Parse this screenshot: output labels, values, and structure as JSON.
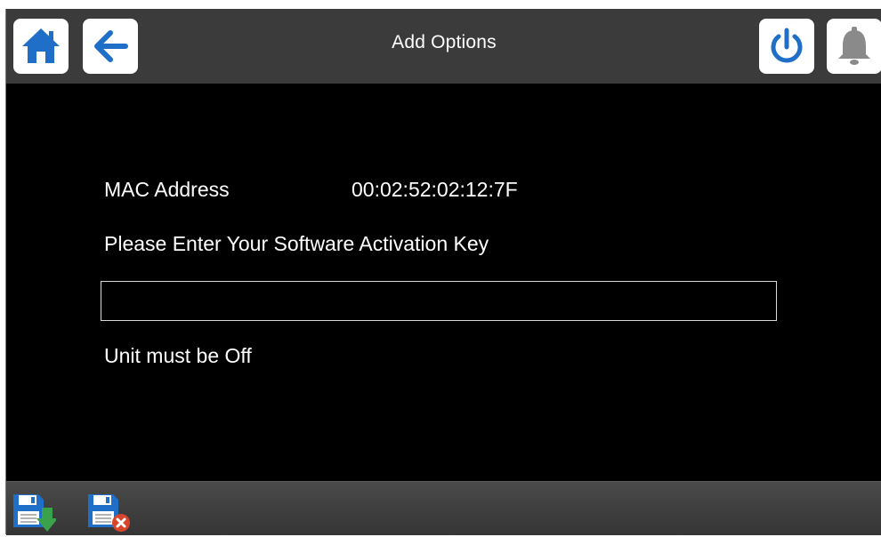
{
  "header": {
    "title": "Add Options",
    "icons": {
      "home": "home-icon",
      "back": "back-arrow-icon",
      "power": "power-icon",
      "alarm": "bell-icon"
    }
  },
  "main": {
    "mac_label": "MAC Address",
    "mac_value": "00:02:52:02:12:7F",
    "prompt": "Please Enter Your Software Activation Key",
    "activation_key_value": "",
    "status": "Unit must be Off"
  },
  "footer": {
    "icons": {
      "save": "save-icon",
      "discard": "discard-icon"
    }
  },
  "colors": {
    "accent_blue": "#1f6fc8",
    "header_bg": "#3b3b3b",
    "background": "#000000",
    "discard_red": "#d9452b",
    "save_green": "#3aa24a"
  }
}
